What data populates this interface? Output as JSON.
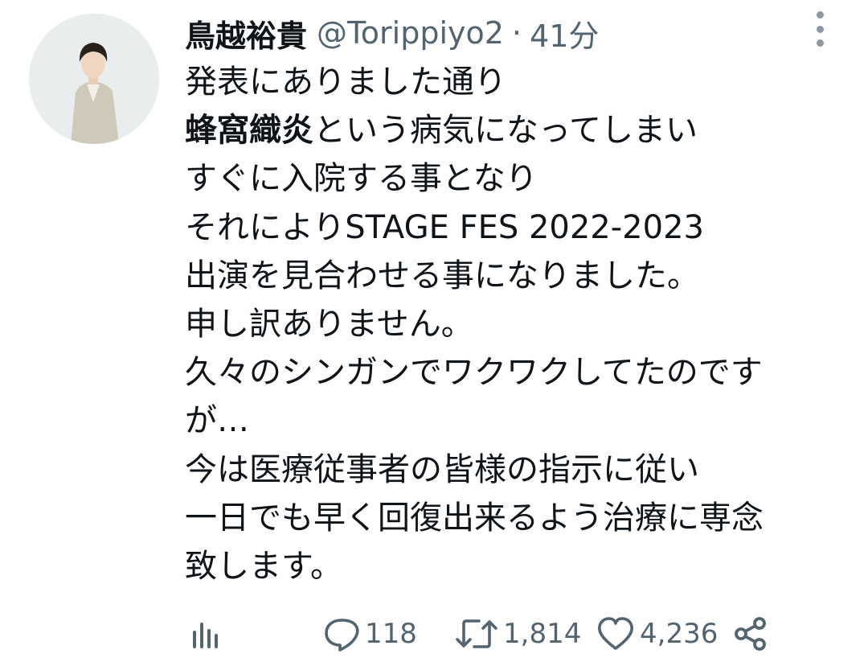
{
  "tweet": {
    "author_name": "鳥越裕貴",
    "author_handle": "@Torippiyo2",
    "separator": "·",
    "time": "41分",
    "lines": [
      "発表にありました通り",
      "という病気になってしまい",
      "すぐに入院する事となり",
      "それによりSTAGE FES 2022-2023",
      "出演を見合わせる事になりました。",
      "申し訳ありません。",
      "久々のシンガンでワクワクしてたのです",
      "が…",
      "今は医療従事者の皆様の指示に従い",
      "一日でも早く回復出来るよう治療に専念",
      "致します。"
    ],
    "bold_phrase": "蜂窩織炎"
  },
  "actions": {
    "replies": "118",
    "retweets": "1,814",
    "likes": "4,236"
  },
  "icons": {
    "more": "more-vertical-icon",
    "analytics": "analytics-icon",
    "reply": "reply-icon",
    "retweet": "retweet-icon",
    "like": "heart-icon",
    "share": "share-icon"
  },
  "colors": {
    "text": "#0f1419",
    "secondary": "#536471",
    "avatar_bg": "#e9eded"
  }
}
